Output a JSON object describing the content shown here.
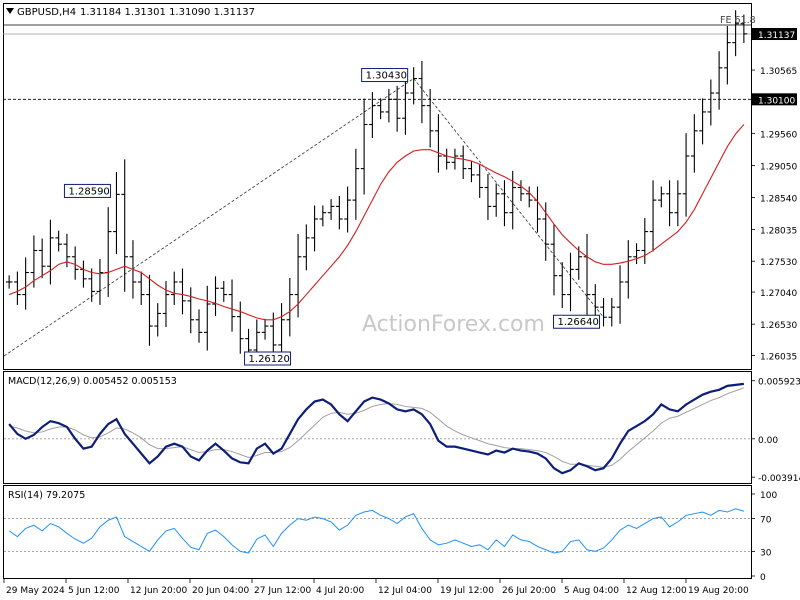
{
  "header": {
    "symbol": "GBPUSD,H4",
    "ohlc": "1.31184 1.31301 1.31090 1.31137"
  },
  "fibo_label": "FE 61.8",
  "watermark": "ActionForex.com",
  "colors": {
    "price": "#000000",
    "ma": "#d21e1e",
    "macd": "#0d1d7a",
    "signal": "#a0a0a0",
    "rsi": "#1e90ff",
    "badge_bg": "#000000",
    "callout_border": "#0d1d7a"
  },
  "chart_data": [
    {
      "type": "line",
      "title": "GBPUSD,H4",
      "ylim": [
        1.2585,
        1.3155
      ],
      "y_ticks": [
        "1.31137",
        "1.30565",
        "1.30100",
        "1.29560",
        "1.29050",
        "1.28540",
        "1.28035",
        "1.27530",
        "1.27040",
        "1.26530",
        "1.26035"
      ],
      "x_ticks": [
        "29 May 2024",
        "5 Jun 12:00",
        "12 Jun 20:00",
        "20 Jun 04:00",
        "27 Jun 12:00",
        "4 Jul 20:00",
        "12 Jul 04:00",
        "19 Jul 12:00",
        "26 Jul 20:00",
        "5 Aug 04:00",
        "12 Aug 12:00",
        "19 Aug 20:00"
      ],
      "current_price": "1.31137",
      "horizontal_level": "1.30100",
      "series": [
        {
          "name": "price",
          "values": [
            1.272,
            1.27,
            1.2735,
            1.277,
            1.2745,
            1.279,
            1.278,
            1.276,
            1.274,
            1.2725,
            1.2705,
            1.2735,
            1.28,
            1.2859,
            1.276,
            1.272,
            1.27,
            1.265,
            1.267,
            1.27,
            1.272,
            1.269,
            1.266,
            1.264,
            1.2685,
            1.271,
            1.27,
            1.2665,
            1.263,
            1.2612,
            1.264,
            1.265,
            1.262,
            1.266,
            1.27,
            1.276,
            1.279,
            1.282,
            1.283,
            1.284,
            1.282,
            1.285,
            1.29,
            1.297,
            1.3,
            1.299,
            1.301,
            1.298,
            1.302,
            1.3043,
            1.3,
            1.296,
            1.292,
            1.291,
            1.292,
            1.29,
            1.289,
            1.287,
            1.284,
            1.286,
            1.283,
            1.287,
            1.286,
            1.285,
            1.282,
            1.278,
            1.273,
            1.27,
            1.274,
            1.276,
            1.27,
            1.268,
            1.2664,
            1.268,
            1.272,
            1.276,
            1.277,
            1.28,
            1.285,
            1.286,
            1.283,
            1.286,
            1.292,
            1.296,
            1.299,
            1.302,
            1.306,
            1.31,
            1.313,
            1.3114
          ]
        },
        {
          "name": "moving average",
          "values": [
            1.27,
            1.2705,
            1.2712,
            1.2722,
            1.273,
            1.2738,
            1.2748,
            1.2752,
            1.2748,
            1.274,
            1.2735,
            1.2733,
            1.2735,
            1.274,
            1.2745,
            1.274,
            1.2735,
            1.2725,
            1.2715,
            1.2707,
            1.2702,
            1.27,
            1.2697,
            1.2693,
            1.269,
            1.2686,
            1.2681,
            1.2677,
            1.2673,
            1.2668,
            1.2663,
            1.266,
            1.266,
            1.2665,
            1.2673,
            1.2685,
            1.27,
            1.2715,
            1.273,
            1.2745,
            1.276,
            1.2778,
            1.28,
            1.2825,
            1.285,
            1.2875,
            1.2895,
            1.291,
            1.292,
            1.2928,
            1.293,
            1.293,
            1.2925,
            1.292,
            1.2917,
            1.2915,
            1.2912,
            1.2907,
            1.29,
            1.2893,
            1.2887,
            1.288,
            1.2872,
            1.2862,
            1.2848,
            1.283,
            1.2812,
            1.2795,
            1.2782,
            1.277,
            1.276,
            1.2752,
            1.2748,
            1.2748,
            1.275,
            1.2753,
            1.2757,
            1.2762,
            1.277,
            1.278,
            1.279,
            1.28,
            1.2815,
            1.2835,
            1.286,
            1.2885,
            1.291,
            1.2935,
            1.2955,
            1.297
          ]
        }
      ],
      "annotations": [
        {
          "label": "1.28590",
          "x_index": 13,
          "value": 1.2859
        },
        {
          "label": "1.26120",
          "x_index": 29,
          "value": 1.2612
        },
        {
          "label": "1.30430",
          "x_index": 49,
          "value": 1.3043
        },
        {
          "label": "1.26640",
          "x_index": 72,
          "value": 1.2664
        }
      ]
    },
    {
      "type": "line",
      "title": "MACD(12,26,9) 0.005452 0.005153",
      "ylim": [
        -0.0042,
        0.0062
      ],
      "y_ticks": [
        "0.005923",
        "0.00",
        "-0.003914"
      ],
      "series": [
        {
          "name": "MACD",
          "values": [
            0.0015,
            0.0005,
            0.0,
            0.0004,
            0.0012,
            0.0018,
            0.0016,
            0.0012,
            0.0,
            -0.001,
            -0.0008,
            0.0005,
            0.0015,
            0.002,
            0.0005,
            -0.0005,
            -0.0015,
            -0.0025,
            -0.0018,
            -0.0008,
            -0.0005,
            -0.0008,
            -0.0018,
            -0.0022,
            -0.0012,
            -0.0005,
            -0.0012,
            -0.002,
            -0.0024,
            -0.0025,
            -0.001,
            -0.0005,
            -0.0015,
            -0.001,
            0.0005,
            0.002,
            0.003,
            0.0038,
            0.004,
            0.0035,
            0.0025,
            0.0018,
            0.0028,
            0.0038,
            0.0042,
            0.004,
            0.0036,
            0.003,
            0.0028,
            0.003,
            0.0025,
            0.0015,
            -0.0002,
            -0.0008,
            -0.0008,
            -0.001,
            -0.0012,
            -0.0014,
            -0.0016,
            -0.0012,
            -0.0014,
            -0.001,
            -0.0012,
            -0.0013,
            -0.0015,
            -0.002,
            -0.003,
            -0.0035,
            -0.0032,
            -0.0025,
            -0.0028,
            -0.0032,
            -0.003,
            -0.002,
            -0.0005,
            0.0008,
            0.0013,
            0.0018,
            0.0025,
            0.0035,
            0.003,
            0.0028,
            0.0035,
            0.004,
            0.0045,
            0.0048,
            0.005,
            0.0054,
            0.0055,
            0.0056
          ]
        },
        {
          "name": "signal",
          "values": [
            0.0013,
            0.0011,
            0.0008,
            0.0006,
            0.0007,
            0.001,
            0.0012,
            0.0012,
            0.0009,
            0.0004,
            0.0001,
            0.0002,
            0.0006,
            0.0011,
            0.001,
            0.0006,
            0.0001,
            -0.0006,
            -0.001,
            -0.001,
            -0.0009,
            -0.0008,
            -0.0011,
            -0.0014,
            -0.0013,
            -0.0011,
            -0.0011,
            -0.0013,
            -0.0016,
            -0.0019,
            -0.0017,
            -0.0014,
            -0.0014,
            -0.0013,
            -0.0009,
            -0.0002,
            0.0006,
            0.0014,
            0.0022,
            0.0026,
            0.0027,
            0.0025,
            0.0026,
            0.0029,
            0.0033,
            0.0035,
            0.0036,
            0.0035,
            0.0033,
            0.0032,
            0.0031,
            0.0027,
            0.002,
            0.0013,
            0.0008,
            0.0004,
            0.0001,
            -0.0002,
            -0.0005,
            -0.0007,
            -0.0009,
            -0.001,
            -0.001,
            -0.0011,
            -0.0012,
            -0.0014,
            -0.0018,
            -0.0023,
            -0.0026,
            -0.0026,
            -0.0027,
            -0.0028,
            -0.0029,
            -0.0027,
            -0.0021,
            -0.0013,
            -0.0006,
            0.0001,
            0.0008,
            0.0016,
            0.0021,
            0.0023,
            0.0027,
            0.0031,
            0.0035,
            0.0039,
            0.0042,
            0.0046,
            0.0049,
            0.0052
          ]
        }
      ]
    },
    {
      "type": "line",
      "title": "RSI(14) 79.2075",
      "ylim": [
        0,
        100
      ],
      "y_ticks": [
        "100",
        "70",
        "30",
        "0"
      ],
      "series": [
        {
          "name": "RSI",
          "values": [
            55,
            48,
            58,
            62,
            55,
            64,
            60,
            52,
            45,
            40,
            46,
            60,
            68,
            72,
            48,
            42,
            36,
            30,
            44,
            55,
            58,
            46,
            35,
            32,
            52,
            56,
            48,
            38,
            30,
            28,
            45,
            50,
            36,
            52,
            62,
            70,
            68,
            72,
            70,
            66,
            56,
            62,
            74,
            78,
            80,
            74,
            70,
            64,
            72,
            76,
            58,
            44,
            38,
            40,
            44,
            40,
            36,
            38,
            32,
            44,
            36,
            50,
            44,
            42,
            36,
            32,
            28,
            30,
            42,
            44,
            32,
            30,
            34,
            44,
            56,
            62,
            58,
            64,
            70,
            72,
            60,
            66,
            74,
            76,
            78,
            74,
            80,
            78,
            82,
            79
          ]
        }
      ]
    }
  ]
}
